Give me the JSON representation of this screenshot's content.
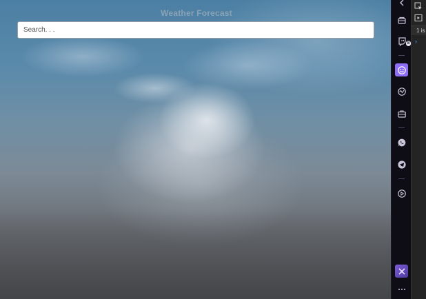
{
  "app": {
    "title": "Weather Forecast"
  },
  "search": {
    "placeholder": "Search. . .",
    "value": ""
  },
  "sidebar": {
    "items": [
      {
        "icon": "chevron-left-icon"
      },
      {
        "icon": "bag-icon"
      },
      {
        "icon": "twitch-icon",
        "badge": "8"
      },
      {
        "icon": "smiley-icon"
      },
      {
        "icon": "radar-icon"
      },
      {
        "icon": "briefcase-icon"
      },
      {
        "icon": "whatsapp-icon"
      },
      {
        "icon": "telegram-icon"
      },
      {
        "icon": "play-circle-icon"
      },
      {
        "icon": "extension-icon"
      },
      {
        "icon": "more-icon"
      }
    ],
    "accent": "#8d6ef5"
  },
  "devtools": {
    "tab_label": "1 is"
  }
}
